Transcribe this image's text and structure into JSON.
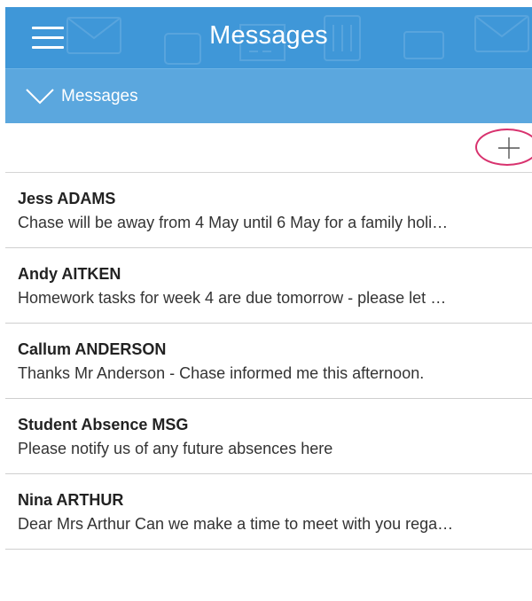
{
  "header": {
    "title": "Messages",
    "background": "#3f97d8"
  },
  "subheader": {
    "label": "Messages",
    "background": "#5ba7de"
  },
  "actions": {
    "add_icon": "plus-icon",
    "highlight_color": "#d8326e"
  },
  "messages": [
    {
      "sender": "Jess ADAMS",
      "preview": "Chase will be away from 4 May until 6 May for a family holi…"
    },
    {
      "sender": "Andy AITKEN",
      "preview": "Homework tasks for week 4 are due tomorrow - please let …"
    },
    {
      "sender": "Callum ANDERSON",
      "preview": "Thanks Mr Anderson - Chase informed me this afternoon."
    },
    {
      "sender": "Student Absence MSG",
      "preview": "Please notify us of any future absences here"
    },
    {
      "sender": "Nina ARTHUR",
      "preview": "Dear Mrs Arthur Can we make a time to meet with you rega…"
    }
  ]
}
